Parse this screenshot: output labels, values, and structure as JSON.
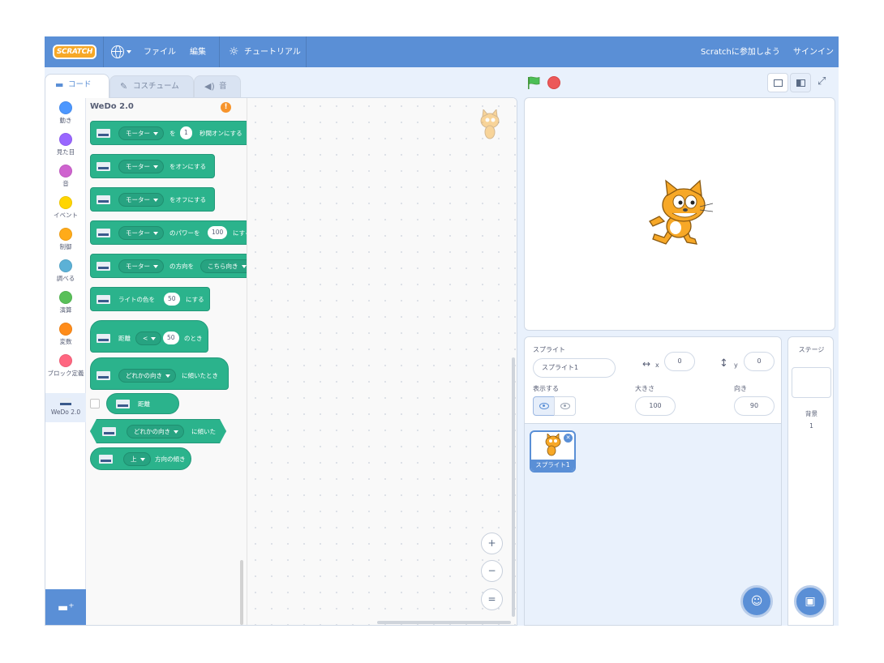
{
  "menubar": {
    "logo": "SCRATCH",
    "file": "ファイル",
    "edit": "編集",
    "tutorial": "チュートリアル",
    "join": "Scratchに参加しよう",
    "signin": "サインイン"
  },
  "tabs": [
    "コード",
    "コスチューム",
    "音"
  ],
  "categories": [
    {
      "label": "動き",
      "color": "#4c97ff"
    },
    {
      "label": "見た目",
      "color": "#9966ff"
    },
    {
      "label": "音",
      "color": "#cf63cf"
    },
    {
      "label": "イベント",
      "color": "#ffd500"
    },
    {
      "label": "制御",
      "color": "#ffab19"
    },
    {
      "label": "調べる",
      "color": "#5cb1d6"
    },
    {
      "label": "演算",
      "color": "#59c059"
    },
    {
      "label": "変数",
      "color": "#ff8c1a"
    },
    {
      "label": "ブロック定義",
      "color": "#ff6680"
    },
    {
      "label": "WeDo 2.0",
      "color": ""
    }
  ],
  "palette": {
    "title": "WeDo 2.0",
    "warning": "!",
    "blocks": {
      "b1": {
        "pill": "モーター",
        "t1": "を",
        "num": "1",
        "t2": "秒間オンにする"
      },
      "b2": {
        "pill": "モーター",
        "t1": "をオンにする"
      },
      "b3": {
        "pill": "モーター",
        "t1": "をオフにする"
      },
      "b4": {
        "pill": "モーター",
        "t1": "のパワーを",
        "num": "100",
        "t2": "にする"
      },
      "b5": {
        "pill": "モーター",
        "t1": "の方向を",
        "pill2": "こちら向き"
      },
      "b6": {
        "t1": "ライトの色を",
        "num": "50",
        "t2": "にする"
      },
      "b7": {
        "t1": "距離",
        "pill": "<",
        "num": "50",
        "t2": "のとき"
      },
      "b8": {
        "pill": "どれかの向き",
        "t1": "に傾いたとき"
      },
      "b9": {
        "t1": "距離"
      },
      "b10": {
        "pill": "どれかの向き",
        "t1": "に傾いた"
      },
      "b11": {
        "pill": "上",
        "t1": "方向の傾き"
      }
    }
  },
  "zoom": {
    "in": "+",
    "out": "−",
    "reset": "="
  },
  "sprite_info": {
    "sprite_label": "スプライト",
    "sprite_name": "スプライト1",
    "x_label": "x",
    "x_value": "0",
    "y_label": "y",
    "y_value": "0",
    "show_label": "表示する",
    "size_label": "大きさ",
    "size_value": "100",
    "direction_label": "向き",
    "direction_value": "90"
  },
  "sprite_list": [
    {
      "name": "スプライト1"
    }
  ],
  "stage_pane": {
    "title": "ステージ",
    "backdrops_label": "背景",
    "backdrops_count": "1"
  },
  "colors": {
    "menubar": "#5a8fd6",
    "motor_block": "#2bb38c",
    "stop": "#ec5959",
    "flag": "#4cbf56"
  }
}
